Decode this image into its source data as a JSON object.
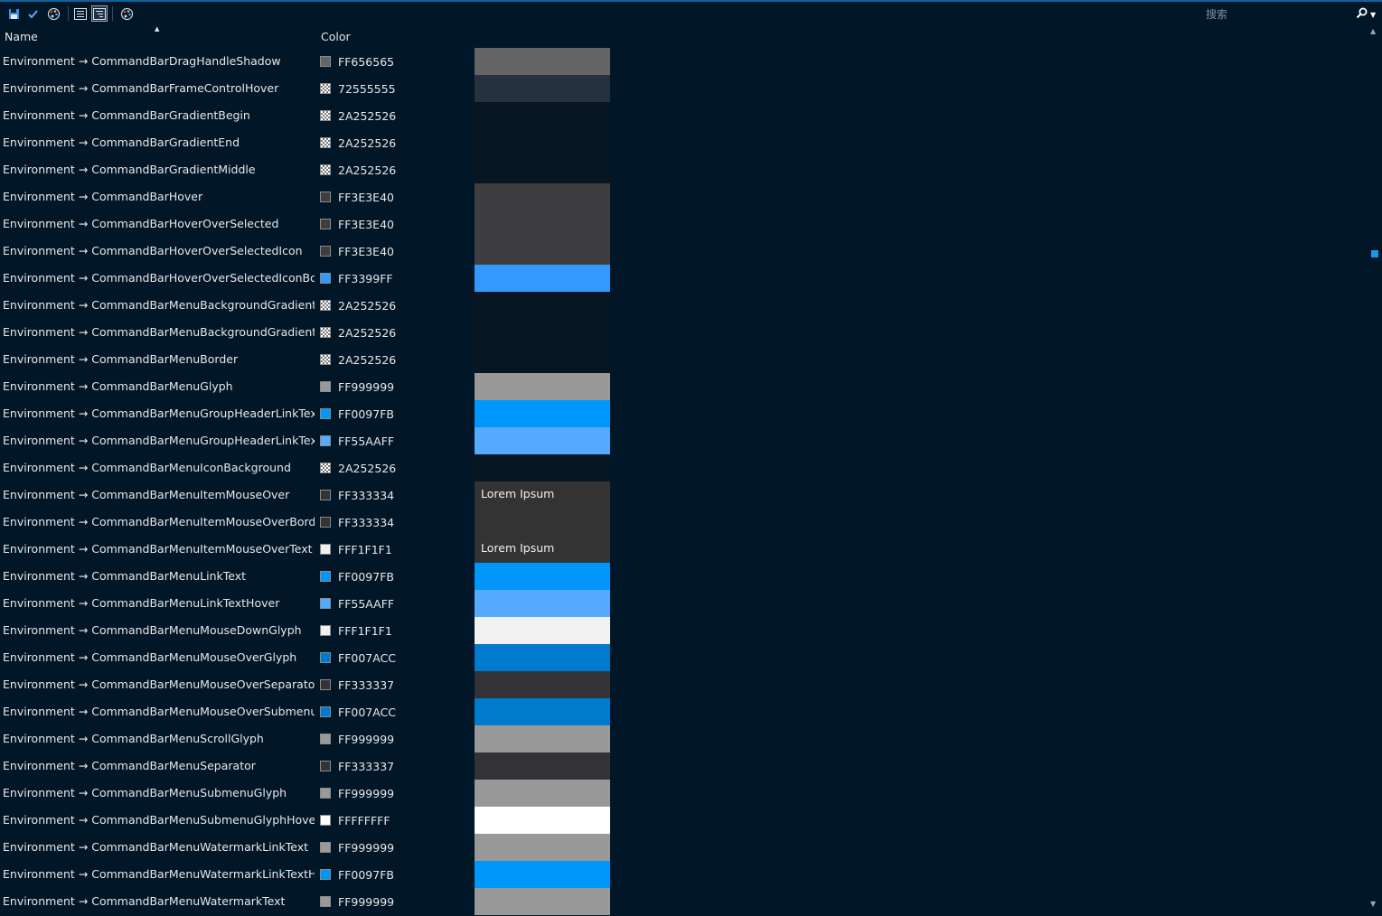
{
  "toolbar": {
    "buttons": [
      "save-icon",
      "checkmark-icon",
      "palette-icon",
      "list-view-icon",
      "tree-view-icon",
      "palette-theme-icon"
    ],
    "search_placeholder": "搜索"
  },
  "table": {
    "columns": {
      "name": "Name",
      "color": "Color"
    },
    "rows": [
      {
        "name": "Environment → CommandBarDragHandleShadow",
        "hex": "FF656565",
        "color": "#656565",
        "checker": false,
        "preview": "#656565",
        "ptext": ""
      },
      {
        "name": "Environment → CommandBarFrameControlHover",
        "hex": "72555555",
        "color": "#555555",
        "checker": true,
        "preview": "#25313e",
        "ptext": ""
      },
      {
        "name": "Environment → CommandBarGradientBegin",
        "hex": "2A252526",
        "color": "#252526",
        "checker": true,
        "preview": "#081622",
        "ptext": ""
      },
      {
        "name": "Environment → CommandBarGradientEnd",
        "hex": "2A252526",
        "color": "#252526",
        "checker": true,
        "preview": "#081622",
        "ptext": ""
      },
      {
        "name": "Environment → CommandBarGradientMiddle",
        "hex": "2A252526",
        "color": "#252526",
        "checker": true,
        "preview": "#081622",
        "ptext": ""
      },
      {
        "name": "Environment → CommandBarHover",
        "hex": "FF3E3E40",
        "color": "#3e3e40",
        "checker": false,
        "preview": "#3e3e40",
        "ptext": ""
      },
      {
        "name": "Environment → CommandBarHoverOverSelected",
        "hex": "FF3E3E40",
        "color": "#3e3e40",
        "checker": false,
        "preview": "#3e3e40",
        "ptext": ""
      },
      {
        "name": "Environment → CommandBarHoverOverSelectedIcon",
        "hex": "FF3E3E40",
        "color": "#3e3e40",
        "checker": false,
        "preview": "#3e3e40",
        "ptext": ""
      },
      {
        "name": "Environment → CommandBarHoverOverSelectedIconBorde",
        "hex": "FF3399FF",
        "color": "#3399ff",
        "checker": false,
        "preview": "#3399ff",
        "ptext": ""
      },
      {
        "name": "Environment → CommandBarMenuBackgroundGradientBeg",
        "hex": "2A252526",
        "color": "#252526",
        "checker": true,
        "preview": "#081622",
        "ptext": ""
      },
      {
        "name": "Environment → CommandBarMenuBackgroundGradientEnd",
        "hex": "2A252526",
        "color": "#252526",
        "checker": true,
        "preview": "#081622",
        "ptext": ""
      },
      {
        "name": "Environment → CommandBarMenuBorder",
        "hex": "2A252526",
        "color": "#252526",
        "checker": true,
        "preview": "#081622",
        "ptext": ""
      },
      {
        "name": "Environment → CommandBarMenuGlyph",
        "hex": "FF999999",
        "color": "#999999",
        "checker": false,
        "preview": "#999999",
        "ptext": ""
      },
      {
        "name": "Environment → CommandBarMenuGroupHeaderLinkText",
        "hex": "FF0097FB",
        "color": "#0097fb",
        "checker": false,
        "preview": "#0097fb",
        "ptext": ""
      },
      {
        "name": "Environment → CommandBarMenuGroupHeaderLinkTextHover",
        "hex": "FF55AAFF",
        "color": "#55aaff",
        "checker": false,
        "preview": "#55aaff",
        "ptext": ""
      },
      {
        "name": "Environment → CommandBarMenuIconBackground",
        "hex": "2A252526",
        "color": "#252526",
        "checker": true,
        "preview": "#081622",
        "ptext": ""
      },
      {
        "name": "Environment → CommandBarMenuItemMouseOver",
        "hex": "FF333334",
        "color": "#333334",
        "checker": false,
        "preview": "#333334",
        "ptext": "Lorem Ipsum"
      },
      {
        "name": "Environment → CommandBarMenuItemMouseOverBorder",
        "hex": "FF333334",
        "color": "#333334",
        "checker": false,
        "preview": "#333334",
        "ptext": ""
      },
      {
        "name": "Environment → CommandBarMenuItemMouseOverText",
        "hex": "FFF1F1F1",
        "color": "#f1f1f1",
        "checker": false,
        "preview": "#333334",
        "ptext": "Lorem Ipsum"
      },
      {
        "name": "Environment → CommandBarMenuLinkText",
        "hex": "FF0097FB",
        "color": "#0097fb",
        "checker": false,
        "preview": "#0097fb",
        "ptext": ""
      },
      {
        "name": "Environment → CommandBarMenuLinkTextHover",
        "hex": "FF55AAFF",
        "color": "#55aaff",
        "checker": false,
        "preview": "#55aaff",
        "ptext": ""
      },
      {
        "name": "Environment → CommandBarMenuMouseDownGlyph",
        "hex": "FFF1F1F1",
        "color": "#f1f1f1",
        "checker": false,
        "preview": "#f1f1f1",
        "ptext": ""
      },
      {
        "name": "Environment → CommandBarMenuMouseOverGlyph",
        "hex": "FF007ACC",
        "color": "#007acc",
        "checker": false,
        "preview": "#007acc",
        "ptext": ""
      },
      {
        "name": "Environment → CommandBarMenuMouseOverSeparator",
        "hex": "FF333337",
        "color": "#333337",
        "checker": false,
        "preview": "#333337",
        "ptext": ""
      },
      {
        "name": "Environment → CommandBarMenuMouseOverSubmenuGlyph",
        "hex": "FF007ACC",
        "color": "#007acc",
        "checker": false,
        "preview": "#007acc",
        "ptext": ""
      },
      {
        "name": "Environment → CommandBarMenuScrollGlyph",
        "hex": "FF999999",
        "color": "#999999",
        "checker": false,
        "preview": "#999999",
        "ptext": ""
      },
      {
        "name": "Environment → CommandBarMenuSeparator",
        "hex": "FF333337",
        "color": "#333337",
        "checker": false,
        "preview": "#333337",
        "ptext": ""
      },
      {
        "name": "Environment → CommandBarMenuSubmenuGlyph",
        "hex": "FF999999",
        "color": "#999999",
        "checker": false,
        "preview": "#999999",
        "ptext": ""
      },
      {
        "name": "Environment → CommandBarMenuSubmenuGlyphHover",
        "hex": "FFFFFFFF",
        "color": "#ffffff",
        "checker": false,
        "preview": "#ffffff",
        "ptext": ""
      },
      {
        "name": "Environment → CommandBarMenuWatermarkLinkText",
        "hex": "FF999999",
        "color": "#999999",
        "checker": false,
        "preview": "#999999",
        "ptext": ""
      },
      {
        "name": "Environment → CommandBarMenuWatermarkLinkTextHover",
        "hex": "FF0097FB",
        "color": "#0097fb",
        "checker": false,
        "preview": "#0097fb",
        "ptext": ""
      },
      {
        "name": "Environment → CommandBarMenuWatermarkText",
        "hex": "FF999999",
        "color": "#999999",
        "checker": false,
        "preview": "#999999",
        "ptext": ""
      }
    ]
  }
}
